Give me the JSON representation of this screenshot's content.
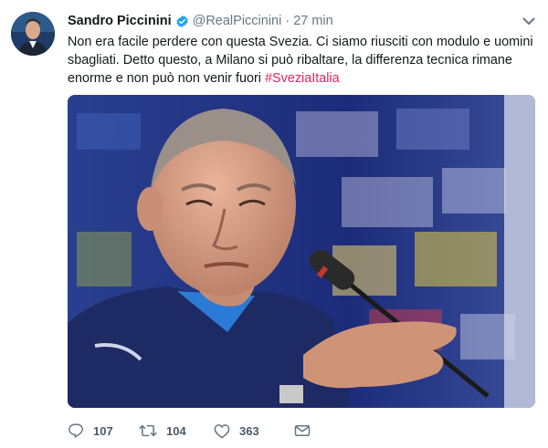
{
  "tweet": {
    "author_name": "Sandro Piccinini",
    "handle": "@RealPiccinini",
    "separator": "·",
    "time": "27 min",
    "text_before": "Non era facile perdere con questa Svezia. Ci siamo riusciti con modulo e uomini sbagliati. Detto questo, a Milano si può ribaltare, la differenza tecnica rimane enorme e non può non venir fuori ",
    "hashtag": "#SveziaItalia",
    "replies": "107",
    "retweets": "104",
    "likes": "363"
  },
  "icons": {
    "verified": "verified-badge-icon",
    "caret": "chevron-down-icon",
    "reply": "reply-icon",
    "retweet": "retweet-icon",
    "like": "heart-icon",
    "dm": "envelope-icon"
  },
  "colors": {
    "verified": "#1da1f2",
    "hashtag": "#e0245e",
    "secondary_text": "#657786"
  }
}
